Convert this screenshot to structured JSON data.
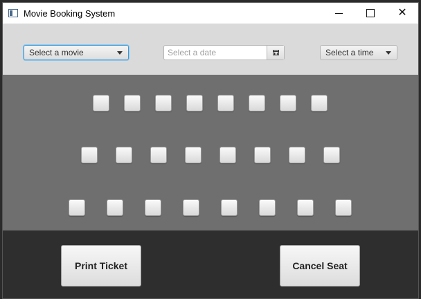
{
  "window": {
    "title": "Movie Booking System",
    "controls": [
      "minimize",
      "maximize",
      "close"
    ]
  },
  "toolbar": {
    "movie_select": {
      "selected": "Select a movie"
    },
    "date_picker": {
      "placeholder": "Select a date",
      "icon": "calendar-icon"
    },
    "time_select": {
      "selected": "Select a time"
    }
  },
  "seats": {
    "rows": [
      {
        "row": 1,
        "count": 8
      },
      {
        "row": 2,
        "count": 8
      },
      {
        "row": 3,
        "count": 8
      }
    ]
  },
  "actions": {
    "print_label": "Print Ticket",
    "cancel_label": "Cancel Seat"
  },
  "colors": {
    "toolbar_bg": "#dadada",
    "seat_area_bg": "#6f6f6f",
    "bottom_bg": "#2e2e2e",
    "focus_accent": "#3b9ad8"
  }
}
